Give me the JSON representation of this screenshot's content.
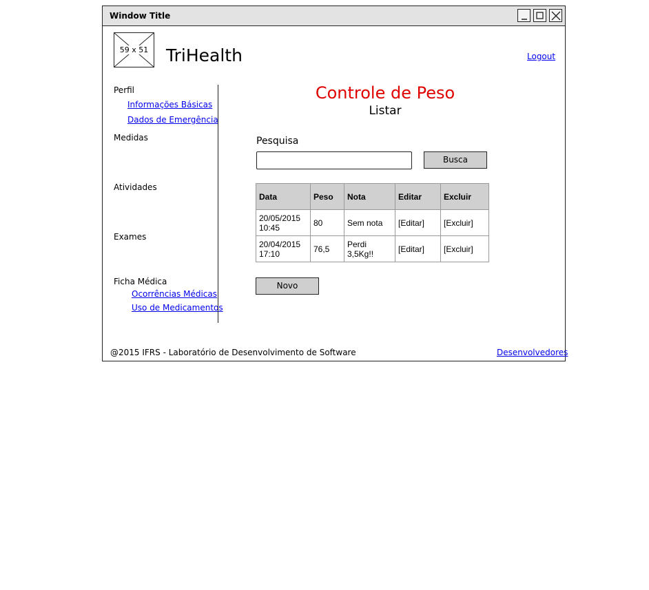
{
  "window": {
    "title": "Window Title"
  },
  "header": {
    "logo_placeholder": "59 x 51",
    "app_name": "TriHealth",
    "logout": "Logout"
  },
  "sidebar": {
    "perfil": {
      "label": "Perfil",
      "links": [
        "Informações Básicas",
        "Dados de Emergência"
      ]
    },
    "medidas": "Medidas",
    "atividades": "Atividades",
    "exames": "Exames",
    "ficha": {
      "label": "Ficha Médica",
      "links": [
        "Ocorrências Médicas",
        "Uso de Medicamentos"
      ]
    }
  },
  "main": {
    "title": "Controle de Peso",
    "subtitle": "Listar",
    "search_label": "Pesquisa",
    "search_value": "",
    "search_button": "Busca",
    "table": {
      "headers": [
        "Data",
        "Peso",
        "Nota",
        "Editar",
        "Excluir"
      ],
      "rows": [
        {
          "data_line1": "20/05/2015",
          "data_line2": "10:45",
          "peso": "80",
          "nota_line1": "Sem nota",
          "nota_line2": "",
          "editar": "[Editar]",
          "excluir": "[Excluir]"
        },
        {
          "data_line1": "20/04/2015",
          "data_line2": "17:10",
          "peso": "76,5",
          "nota_line1": "Perdi",
          "nota_line2": "3,5Kg!!",
          "editar": "[Editar]",
          "excluir": "[Excluir]"
        }
      ]
    },
    "new_button": "Novo"
  },
  "footer": {
    "copyright": "@2015 IFRS - Laboratório de Desenvolvimento de Software",
    "developers": "Desenvolvedores"
  },
  "colors": {
    "title_red": "#e00000",
    "link_blue": "#0000ee",
    "button_gray": "#cfcfcf",
    "header_gray": "#d0d0d0"
  }
}
